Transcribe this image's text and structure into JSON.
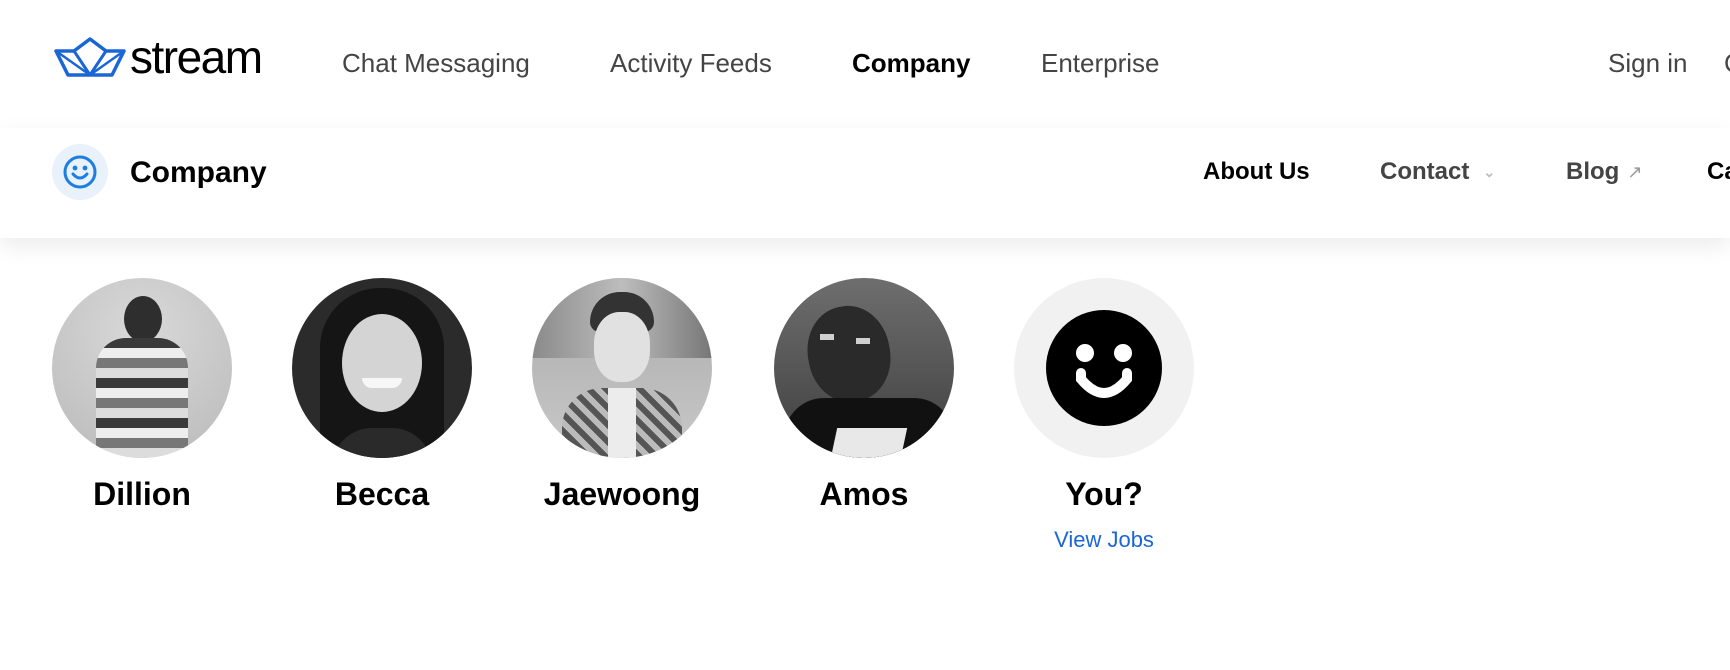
{
  "brand": {
    "name": "stream",
    "color": "#1a66d6"
  },
  "topnav": {
    "links": [
      "Chat Messaging",
      "Activity Feeds",
      "Company",
      "Enterprise"
    ],
    "active": "Company",
    "sign_in": "Sign in",
    "cutoff_char": "C"
  },
  "subnav": {
    "icon": "smiley-icon",
    "title": "Company",
    "links": {
      "about": "About Us",
      "contact": "Contact",
      "blog": "Blog",
      "cutoff": "Ca"
    }
  },
  "team": {
    "members": [
      {
        "name": "Dillion"
      },
      {
        "name": "Becca"
      },
      {
        "name": "Jaewoong"
      },
      {
        "name": "Amos"
      },
      {
        "name": "You?",
        "link": "View Jobs"
      }
    ]
  }
}
